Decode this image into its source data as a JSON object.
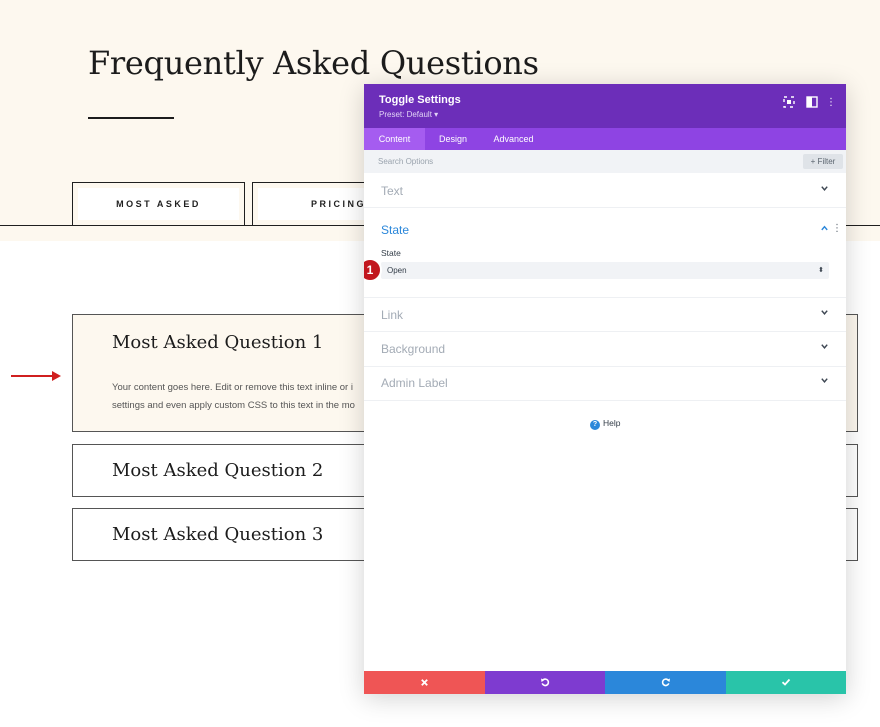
{
  "page": {
    "title": "Frequently Asked Questions",
    "tabs": [
      {
        "label": "MOST ASKED"
      },
      {
        "label": "PRICING"
      }
    ],
    "faqs": [
      {
        "question": "Most Asked Question 1",
        "body_line1": "Your content goes here. Edit or remove this text inline or i",
        "body_line2": "settings and even apply custom CSS to this text in the mo"
      },
      {
        "question": "Most Asked Question 2"
      },
      {
        "question": "Most Asked Question 3"
      }
    ]
  },
  "modal": {
    "title": "Toggle Settings",
    "preset": "Preset: Default ▾",
    "tabs": [
      {
        "label": "Content"
      },
      {
        "label": "Design"
      },
      {
        "label": "Advanced"
      }
    ],
    "search_placeholder": "Search Options",
    "filter_label": "+ Filter",
    "sections": {
      "text": "Text",
      "state": "State",
      "link": "Link",
      "background": "Background",
      "admin_label": "Admin Label"
    },
    "state_field_label": "State",
    "state_value": "Open",
    "badge_number": "1",
    "help_label": "Help"
  },
  "colors": {
    "header_purple": "#6c2eb9",
    "tab_purple": "#8e44e3",
    "accent_blue": "#2b87da",
    "cancel_red": "#ef5555",
    "undo_purple": "#7e3bd0",
    "redo_blue": "#2b87da",
    "save_green": "#29c4a9",
    "hero_bg": "#fdf8ef",
    "badge_red": "#c2171e"
  },
  "icons": {
    "header": [
      "fullscreen-icon",
      "split-view-icon",
      "more-options-icon"
    ],
    "footer": [
      "close-icon",
      "undo-icon",
      "redo-icon",
      "check-icon"
    ]
  }
}
